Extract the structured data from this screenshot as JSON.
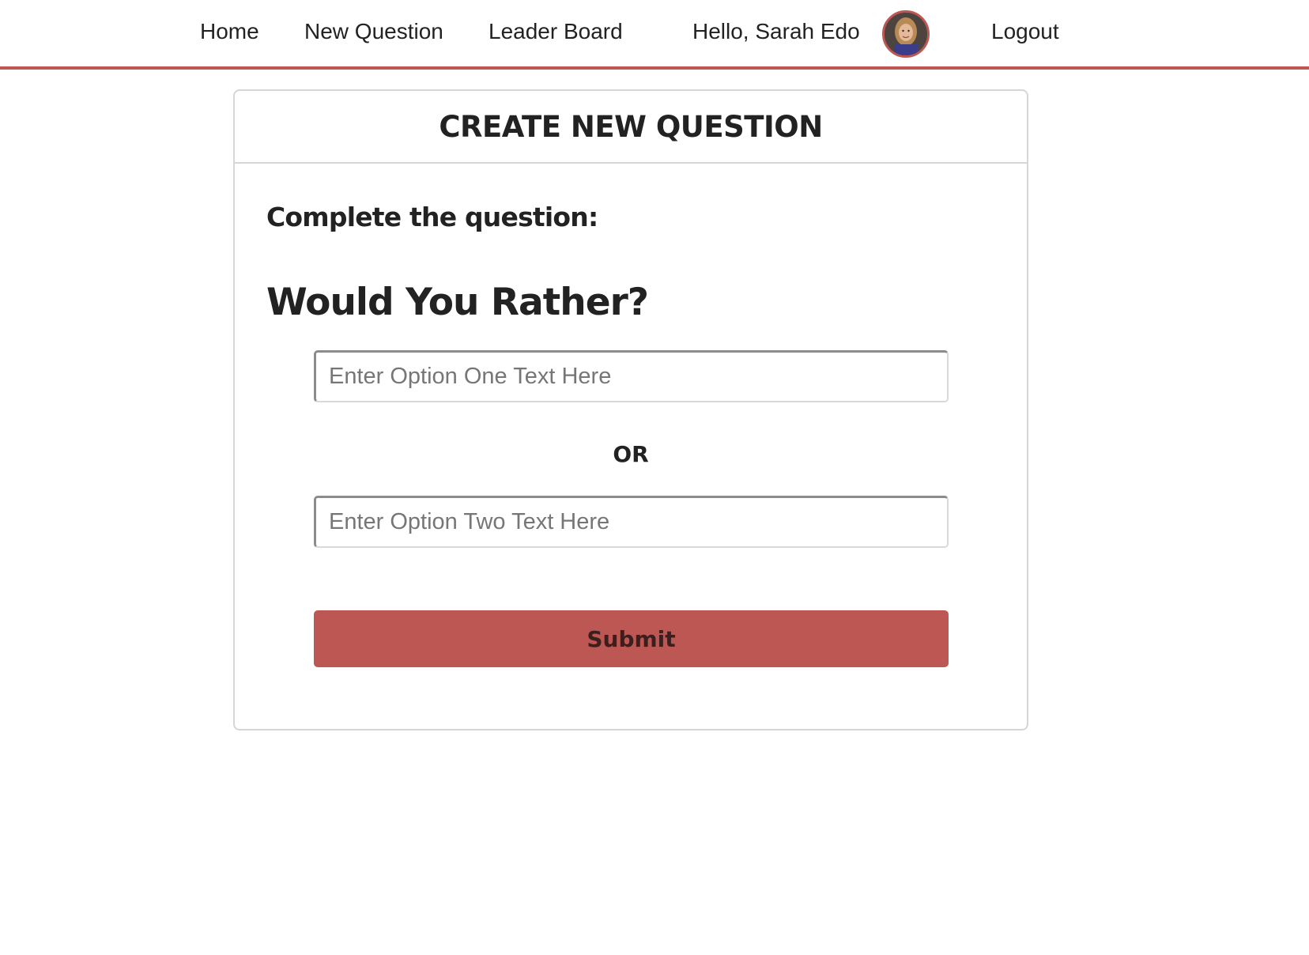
{
  "nav": {
    "home": "Home",
    "new_question": "New Question",
    "leader_board": "Leader Board",
    "greeting": "Hello, Sarah Edo",
    "logout": "Logout"
  },
  "card": {
    "title": "CREATE NEW QUESTION",
    "prompt": "Complete the question:",
    "heading": "Would You Rather?",
    "option_one": {
      "value": "",
      "placeholder": "Enter Option One Text Here"
    },
    "separator": "OR",
    "option_two": {
      "value": "",
      "placeholder": "Enter Option Two Text Here"
    },
    "submit_label": "Submit"
  },
  "colors": {
    "accent": "#bc5753",
    "border": "#d6d6d6",
    "text": "#222222"
  }
}
